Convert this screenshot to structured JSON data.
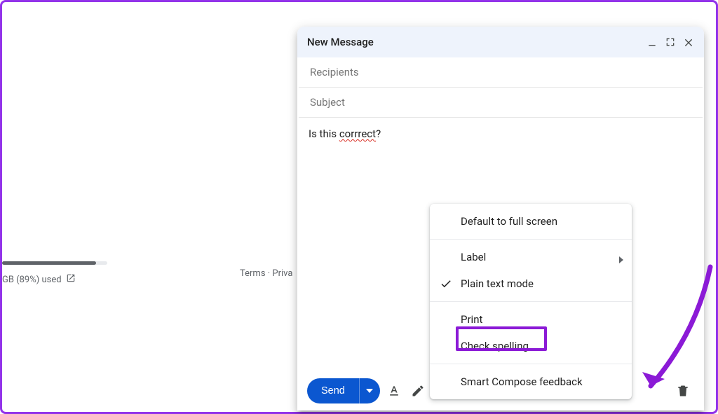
{
  "storage": {
    "text": "GB (89%) used",
    "percent_fill": 89
  },
  "footer_links": "Terms · Priva",
  "compose": {
    "title": "New Message",
    "recipients_placeholder": "Recipients",
    "subject_placeholder": "Subject",
    "body_prefix": "Is this ",
    "body_misspelled": "corrrect",
    "body_suffix": "?",
    "send_label": "Send"
  },
  "menu": {
    "default_fullscreen": "Default to full screen",
    "label": "Label",
    "plain_text": "Plain text mode",
    "print": "Print",
    "check_spelling": "Check spelling",
    "smart_compose": "Smart Compose feedback"
  }
}
